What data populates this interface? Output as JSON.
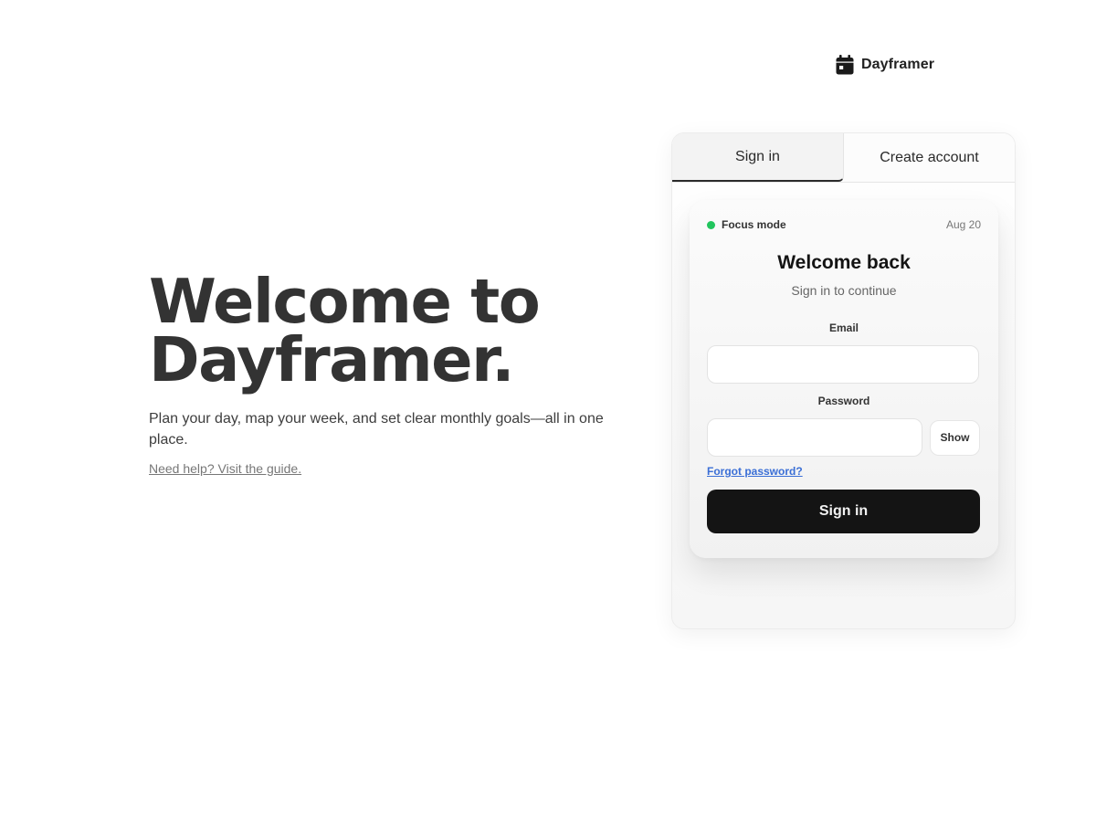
{
  "brand": {
    "name": "Dayframer",
    "icon": "calendar-icon"
  },
  "hero": {
    "title_line1": "Welcome to",
    "title_line2": "Dayframer.",
    "description": "Plan your day, map your week, and set clear monthly goals—all in one place.",
    "help_link": "Need help? Visit the guide."
  },
  "auth": {
    "tabs": [
      {
        "label": "Sign in",
        "active": true
      },
      {
        "label": "Create account",
        "active": false
      }
    ],
    "card": {
      "status_label": "Focus mode",
      "status_color": "#22c55e",
      "date": "Aug 20",
      "title": "Welcome back",
      "subtitle": "Sign in to continue",
      "email_label": "Email",
      "email_value": "",
      "password_label": "Password",
      "password_value": "",
      "show_label": "Show",
      "forgot_label": "Forgot password?",
      "submit_label": "Sign in"
    }
  },
  "colors": {
    "primary_button": "#141414",
    "link": "#3b6fd6",
    "status_dot": "#22c55e"
  }
}
